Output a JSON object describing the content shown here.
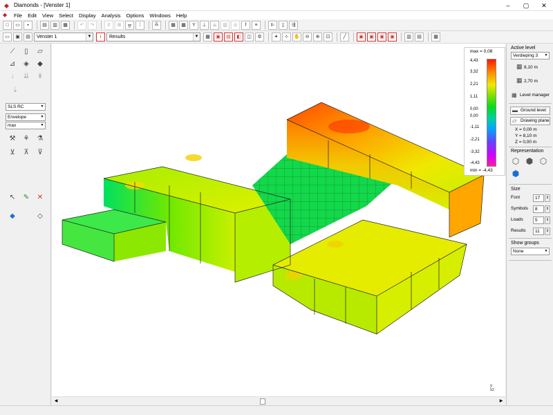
{
  "window": {
    "title": "Diamonds - [Venster 1]",
    "controls": [
      "–",
      "▢",
      "✕"
    ]
  },
  "menu": [
    "File",
    "Edit",
    "View",
    "Select",
    "Display",
    "Analysis",
    "Options",
    "Windows",
    "Help"
  ],
  "toolbar2": {
    "view_combo": "Venster 1",
    "results_combo": "Results"
  },
  "left_panel": {
    "loadcase_combo": "SLS RC",
    "envelope_combo": "Envelope",
    "max_combo": "max"
  },
  "legend": {
    "max_label": "max = 0,08",
    "min_label": "min = -4,43",
    "ticks": [
      "4,43",
      "3,32",
      "2,21",
      "1,11",
      "0,00",
      "0,00",
      "-1,11",
      "-2,21",
      "-3,32",
      "-4,43"
    ]
  },
  "axis_label": "y\nxz",
  "right_panel": {
    "active_level_title": "Active level",
    "level_combo": "Verdieping 3",
    "level_top": "8,10 m",
    "level_bottom": "2,70 m",
    "level_manager": "Level manager",
    "ground_level": "Ground level",
    "drawing_plane": "Drawing plane",
    "x": "X  =    0,00 m",
    "y": "Y  =    8,10 m",
    "z": "Z  =    0,00 m",
    "representation_title": "Representation",
    "size_title": "Size",
    "size": [
      {
        "label": "Font",
        "value": "17"
      },
      {
        "label": "Symbols",
        "value": "8"
      },
      {
        "label": "Loads",
        "value": "5"
      },
      {
        "label": "Results",
        "value": "11"
      }
    ],
    "show_groups_title": "Show groups",
    "groups_combo": "None"
  }
}
